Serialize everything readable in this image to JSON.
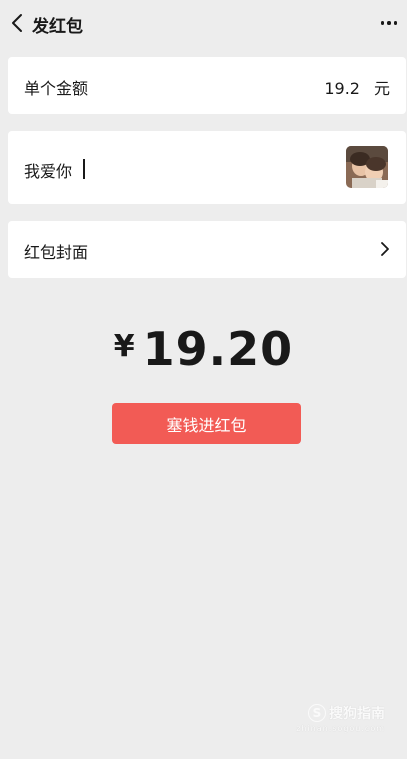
{
  "header": {
    "title": "发红包",
    "back_icon": "chevron-left-icon",
    "more_icon": "more-dots-icon"
  },
  "amount_row": {
    "label": "单个金额",
    "value": "19.2",
    "unit": "元"
  },
  "message_row": {
    "text": "我爱你",
    "sticker_icon": "photo-sticker-icon"
  },
  "cover_row": {
    "label": "红包封面",
    "chevron_icon": "chevron-right-icon"
  },
  "total": {
    "symbol": "¥",
    "amount": "19.20"
  },
  "send_button": {
    "label": "塞钱进红包"
  },
  "watermark": {
    "logo": "S",
    "text": "搜狗指南",
    "url": "zhinan.sogou.com"
  },
  "colors": {
    "background": "#ededed",
    "card": "#ffffff",
    "send_button": "#f25b55",
    "text": "#191919"
  }
}
